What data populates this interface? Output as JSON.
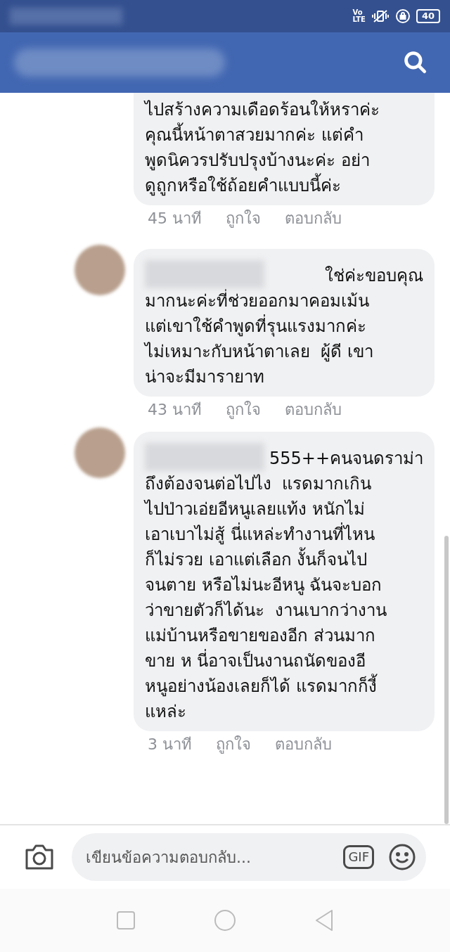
{
  "status_bar": {
    "network": [
      "Vo",
      "LTE"
    ],
    "battery": "40"
  },
  "comments": [
    {
      "lines": [
        "ไปสร้างความเดือดร้อนให้หราค่ะ",
        "คุณนี้หน้าตาสวยมากค่ะ แต่คำ",
        "พูดนิควรปรับปรุงบ้างนะค่ะ อย่า",
        "ดูถูกหรือใช้ถ้อยคำแบบนี้ค่ะ"
      ],
      "time": "45 นาที",
      "like": "ถูกใจ",
      "reply": "ตอบกลับ"
    },
    {
      "avatar": true,
      "name_hidden": true,
      "first_line_tail": "ใช่ค่ะขอบคุณ",
      "lines": [
        "มากนะค่ะที่ช่วยออกมาคอมเม้น",
        "แต่เขาใช้คำพูดที่รุนแรงมากค่ะ",
        "ไม่เหมาะกับหน้าตาเลย  ผู้ดี เขา",
        "น่าจะมีมารายาท"
      ],
      "time": "43 นาที",
      "like": "ถูกใจ",
      "reply": "ตอบกลับ"
    },
    {
      "avatar": true,
      "name_hidden": true,
      "first_line_tail": "555++คนจนดราม่า",
      "lines": [
        "ถึงต้องจนต่อไปไง  แรดมากเกิน",
        "ไปป่าวเอ่ยอีหนูเลยแท้ง หนักไม่",
        "เอาเบาไม่สู้ นี่แหล่ะทำงานที่ไหน",
        "ก็ไม่รวย เอาแต่เลือก งั้นก็จนไป",
        "จนตาย หรือไม่นะอีหนู ฉันจะบอก",
        "ว่าขายตัวก็ได้นะ  งานเบากว่างาน",
        "แม่บ้านหรือขายของอีก ส่วนมาก",
        "ขาย ห นี่อาจเป็นงานถนัดของอี",
        "หนูอย่างน้องเลยก็ได้ แรดมากก็งี้",
        "แหล่ะ"
      ],
      "time": "3 นาที",
      "like": "ถูกใจ",
      "reply": "ตอบกลับ"
    }
  ],
  "reply_box": {
    "placeholder": "เขียนข้อความตอบกลับ...",
    "gif": "GIF"
  }
}
